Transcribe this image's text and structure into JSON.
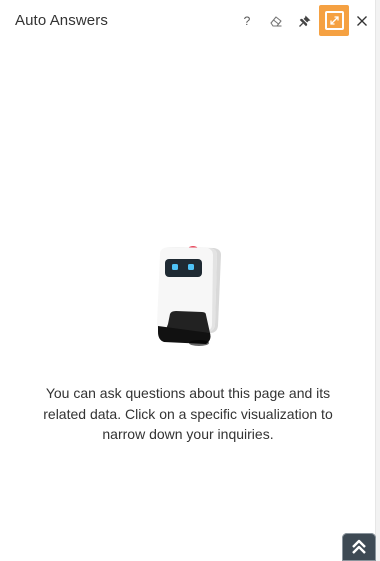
{
  "header": {
    "title": "Auto Answers",
    "help_label": "?"
  },
  "icons": {
    "help": "help-icon",
    "clear": "eraser-icon",
    "pin": "pin-icon",
    "expand": "expand-icon",
    "close": "close-icon",
    "scroll_top": "double-chevron-up-icon"
  },
  "colors": {
    "accent": "#f5a142",
    "scroll_button": "#3e4a54"
  },
  "empty_state": {
    "message": "You can ask questions about this page and its related data. Click on a specific visualization to narrow down your inquiries."
  }
}
